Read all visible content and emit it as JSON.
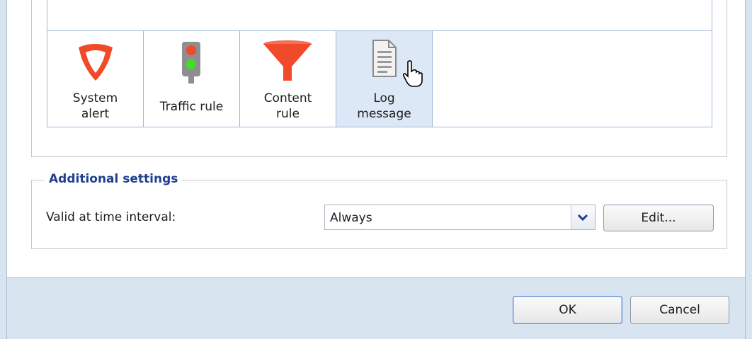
{
  "toolbar": {
    "items": [
      {
        "label_line1": "System",
        "label_line2": "alert",
        "icon": "shield-icon",
        "color": "#f04a2a"
      },
      {
        "label_line1": "Traffic rule",
        "label_line2": "",
        "icon": "traffic-light-icon",
        "color": "#808080"
      },
      {
        "label_line1": "Content",
        "label_line2": "rule",
        "icon": "funnel-icon",
        "color": "#f04a2a"
      },
      {
        "label_line1": "Log",
        "label_line2": "message",
        "icon": "document-icon",
        "color": "#808080"
      }
    ],
    "selected": "Log message"
  },
  "additional": {
    "title": "Additional settings",
    "interval_label": "Valid at time interval:",
    "interval_value": "Always",
    "edit_label": "Edit..."
  },
  "footer": {
    "ok_label": "OK",
    "cancel_label": "Cancel"
  },
  "colors": {
    "accent_title": "#1f3f8f",
    "selected_bg": "#dde8f6",
    "frame": "#d9e4f1",
    "icon_red": "#f04a2a"
  }
}
